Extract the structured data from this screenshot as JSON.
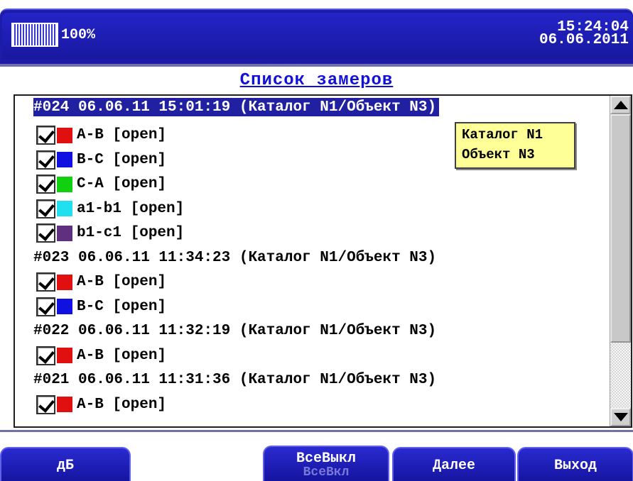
{
  "status": {
    "battery_percent": "100%",
    "battery_level": 1.0,
    "time": "15:24:04",
    "date": "06.06.2011"
  },
  "title": "Список замеров",
  "measurements": [
    {
      "header": "#024 06.06.11 15:01:19 (Каталог N1/Объект N3)",
      "selected": true,
      "channels": [
        {
          "label": "A-B [open]",
          "color": "#e01010",
          "checked": true
        },
        {
          "label": "B-C [open]",
          "color": "#1010e0",
          "checked": true
        },
        {
          "label": "C-A [open]",
          "color": "#10d010",
          "checked": true
        },
        {
          "label": "a1-b1 [open]",
          "color": "#20e0f0",
          "checked": true
        },
        {
          "label": "b1-c1 [open]",
          "color": "#603080",
          "checked": true
        }
      ]
    },
    {
      "header": "#023 06.06.11 11:34:23 (Каталог N1/Объект N3)",
      "selected": false,
      "channels": [
        {
          "label": "A-B [open]",
          "color": "#e01010",
          "checked": true
        },
        {
          "label": "B-C [open]",
          "color": "#1010e0",
          "checked": true
        }
      ]
    },
    {
      "header": "#022 06.06.11 11:32:19 (Каталог N1/Объект N3)",
      "selected": false,
      "channels": [
        {
          "label": "A-B [open]",
          "color": "#e01010",
          "checked": true
        }
      ]
    },
    {
      "header": "#021 06.06.11 11:31:36 (Каталог N1/Объект N3)",
      "selected": false,
      "channels": [
        {
          "label": "A-B [open]",
          "color": "#e01010",
          "checked": true
        }
      ]
    }
  ],
  "tooltip": {
    "line1": "Каталог N1",
    "line2": "Объект N3"
  },
  "buttons": {
    "db": "дБ",
    "all_off": "ВсеВыкл",
    "all_on": "ВсеВкл",
    "next": "Далее",
    "exit": "Выход"
  },
  "colors": {
    "bar_blue": "#1c1ca8",
    "title_blue": "#1010d8",
    "selection": "#2020a0",
    "tooltip_bg": "#ffff98"
  }
}
